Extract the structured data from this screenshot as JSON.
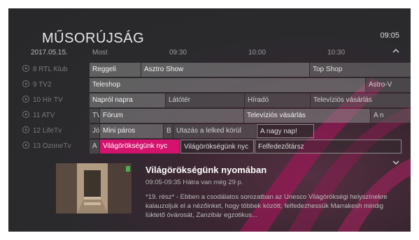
{
  "header": {
    "title": "MŰSORÚJSÁG",
    "clock": "09:05"
  },
  "timebar": {
    "date": "2017.05.15.",
    "now": "Most",
    "t1": "09:30",
    "t2": "10:00",
    "t3": "10:30"
  },
  "channels": [
    {
      "name": "8 RTL Klub",
      "programs": [
        "Reggeli",
        "Asztro Show",
        "Top Shop"
      ]
    },
    {
      "name": "9 TV2",
      "programs": [
        "Teleshop",
        "Astro-V"
      ]
    },
    {
      "name": "10 Hír TV",
      "programs": [
        "Napról napra",
        "Látótér",
        "Híradó",
        "Televíziós vásárlás"
      ]
    },
    {
      "name": "11 ATV",
      "programs": [
        "TV",
        "Fórum",
        "Televíziós vásárlás",
        "A n"
      ]
    },
    {
      "name": "12 LifeTv",
      "programs": [
        "Jó",
        "Mini páros",
        "B",
        "Utazás a lelked körül",
        "A nagy nap!"
      ]
    },
    {
      "name": "13 OzoneTv",
      "programs": [
        "A",
        "Világörökségünk nyc",
        "Világörökségünk nyc",
        "Felfedezőtársz"
      ]
    }
  ],
  "detail": {
    "title": "Világörökségünk nyomában",
    "time": "09:05-09:35 Hátra van még 29 p.",
    "description": "*19. rész* - Ebben a csodálatos sorozatban az Unesco Világörökségi helyszínekre kalauzoljuk el a nézőinket, hogy többek között, felfedezhessük Marrakesh mindig lüktető óvárosát, Zanzibár egzotikus..."
  },
  "colors": {
    "accent": "#d4136f",
    "background": "#2a2a2d"
  },
  "icons": {
    "up": "chevron-up-icon",
    "down": "chevron-down-icon",
    "channel": "play-circle-icon"
  }
}
